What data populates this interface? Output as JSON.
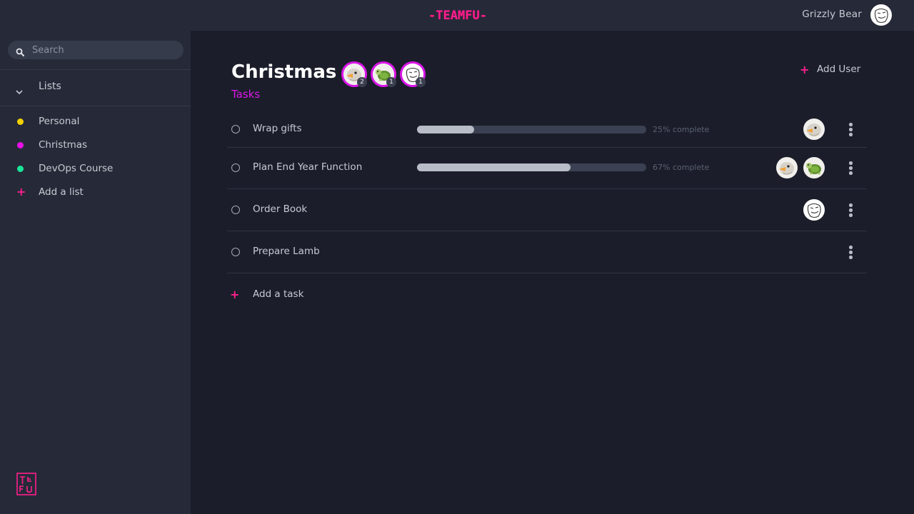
{
  "app": {
    "brand": "-TEAMFU-",
    "user_name": "Grizzly Bear",
    "accent_color": "#ff1f8e",
    "highlight_color": "#d916e8"
  },
  "sidebar": {
    "search_placeholder": "Search",
    "lists_label": "Lists",
    "lists": [
      {
        "label": "Personal",
        "color": "#f2d100"
      },
      {
        "label": "Christmas",
        "color": "#e910e8"
      },
      {
        "label": "DevOps Course",
        "color": "#19e699"
      }
    ],
    "add_list_label": "Add a list"
  },
  "main": {
    "title": "Christmas",
    "subtitle": "Tasks",
    "add_user_label": "Add User",
    "members": [
      {
        "avatar": "bird-avatar",
        "count": "2"
      },
      {
        "avatar": "turtle-avatar",
        "count": "1"
      },
      {
        "avatar": "meme-face-avatar",
        "count": "1"
      }
    ],
    "tasks": [
      {
        "name": "Wrap gifts",
        "progress": 0.25,
        "progress_label": "25% complete",
        "assignees": [
          "bird-avatar"
        ]
      },
      {
        "name": "Plan End Year Function",
        "progress": 0.67,
        "progress_label": "67% complete",
        "assignees": [
          "bird-avatar",
          "turtle-avatar"
        ]
      },
      {
        "name": "Order Book",
        "progress": null,
        "progress_label": "",
        "assignees": [
          "meme-face-avatar"
        ]
      },
      {
        "name": "Prepare Lamb",
        "progress": null,
        "progress_label": "",
        "assignees": []
      }
    ],
    "add_task_label": "Add a task"
  }
}
